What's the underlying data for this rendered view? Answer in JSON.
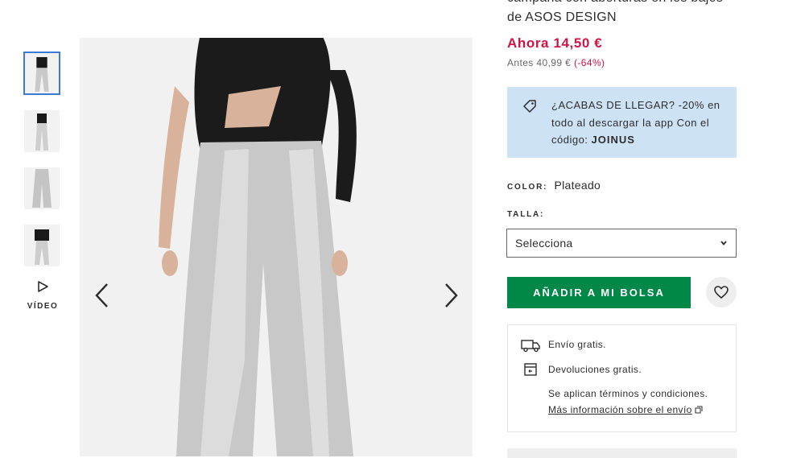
{
  "product": {
    "title": "campana con aberturas en los bajos de ASOS DESIGN",
    "price_now": "Ahora 14,50 €",
    "price_before": "Antes 40,99 €",
    "discount": "(-64%)"
  },
  "promo": {
    "text": "¿ACABAS DE LLEGAR? -20% en todo al descargar la app Con el código:",
    "code": "JOINUS"
  },
  "color": {
    "label": "COLOR:",
    "value": "Plateado"
  },
  "size": {
    "label": "TALLA:",
    "selected": "Selecciona"
  },
  "actions": {
    "add_to_bag": "AÑADIR A MI BOLSA"
  },
  "gallery": {
    "video_label": "VÍDEO"
  },
  "delivery": {
    "free_shipping": "Envío gratis.",
    "free_returns": "Devoluciones gratis.",
    "terms": "Se aplican términos y condiciones.",
    "more_info": "Más información sobre el envío"
  },
  "colors": {
    "price": "#d01345",
    "cta": "#018849",
    "promo_bg": "#cde2f5"
  }
}
